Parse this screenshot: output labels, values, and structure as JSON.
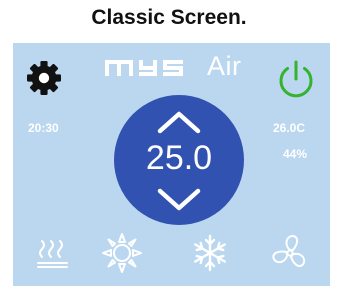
{
  "page": {
    "title": "Classic Screen."
  },
  "brand": {
    "name": "MYS",
    "suffix": "Air"
  },
  "status": {
    "time": "20:30",
    "temperature": "26.0C",
    "humidity": "44%"
  },
  "setpoint": {
    "value": "25.0"
  },
  "icons": {
    "settings": "gear-icon",
    "power": "power-icon",
    "increase": "chevron-up-icon",
    "decrease": "chevron-down-icon",
    "modes": [
      "heat-waves-icon",
      "sun-icon",
      "snowflake-icon",
      "fan-icon"
    ]
  },
  "colors": {
    "screen_background": "#bad7ef",
    "dial": "#3152b0",
    "power_accent": "#35b22f",
    "foreground": "#ffffff",
    "settings_icon": "#111111"
  }
}
